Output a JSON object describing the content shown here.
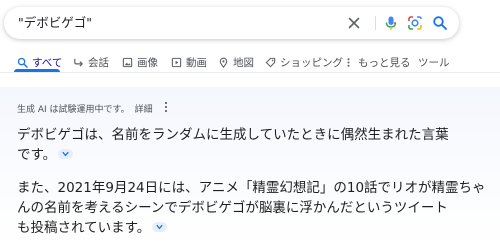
{
  "search": {
    "query": "\"デボビゲゴ\""
  },
  "tabs": [
    {
      "label": "すべて",
      "icon": "search-icon",
      "active": true
    },
    {
      "label": "会話",
      "icon": "conversation-arrow-icon"
    },
    {
      "label": "画像",
      "icon": "image-icon"
    },
    {
      "label": "動画",
      "icon": "video-play-icon"
    },
    {
      "label": "地図",
      "icon": "map-pin-icon"
    },
    {
      "label": "ショッピング",
      "icon": "tag-icon"
    },
    {
      "label": "もっと見る",
      "icon": "more-vert-icon"
    },
    {
      "label": "ツール"
    }
  ],
  "sge": {
    "notice": "生成 AI は試験運用中です。",
    "details_link": "詳細",
    "paragraphs": [
      {
        "lines": [
          "デボビゲゴは、名前をランダムに生成していたときに偶然生まれた言葉",
          "です。"
        ]
      },
      {
        "lines": [
          "また、2021年9月24日には、アニメ「精霊幻想記」の10話でリオが精霊ちゃ",
          "んの名前を考えるシーンでデボビゲゴが脳裏に浮かんだというツイート",
          "も投稿されています。"
        ]
      }
    ]
  },
  "colors": {
    "accent": "#1a73e8",
    "active_tab_text": "#1a0dab",
    "text": "#1f1f1f",
    "muted": "#4d5156"
  }
}
